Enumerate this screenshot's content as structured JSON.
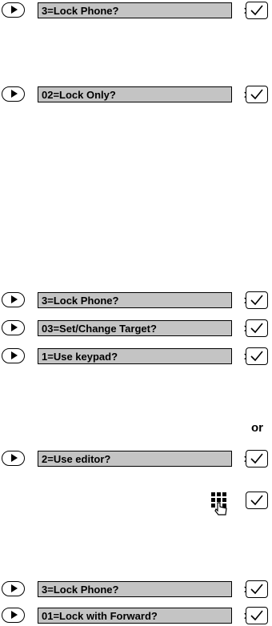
{
  "rows": [
    {
      "label": "3=Lock Phone?",
      "gt": ">"
    },
    {
      "label": "02=Lock Only?",
      "gt": ">"
    },
    {
      "label": "3=Lock Phone?",
      "gt": ">"
    },
    {
      "label": "03=Set/Change Target?",
      "gt": ">"
    },
    {
      "label": "1=Use keypad?",
      "gt": ">"
    },
    {
      "label": "2=Use editor?",
      "gt": ">"
    },
    {
      "label": "3=Lock Phone?",
      "gt": ">"
    },
    {
      "label": "01=Lock with Forward?",
      "gt": ">"
    }
  ],
  "or_text": "or",
  "icons": {
    "arrow": "play-arrow-icon",
    "check": "checkmark-icon",
    "keypad": "keypad-hand-icon"
  }
}
